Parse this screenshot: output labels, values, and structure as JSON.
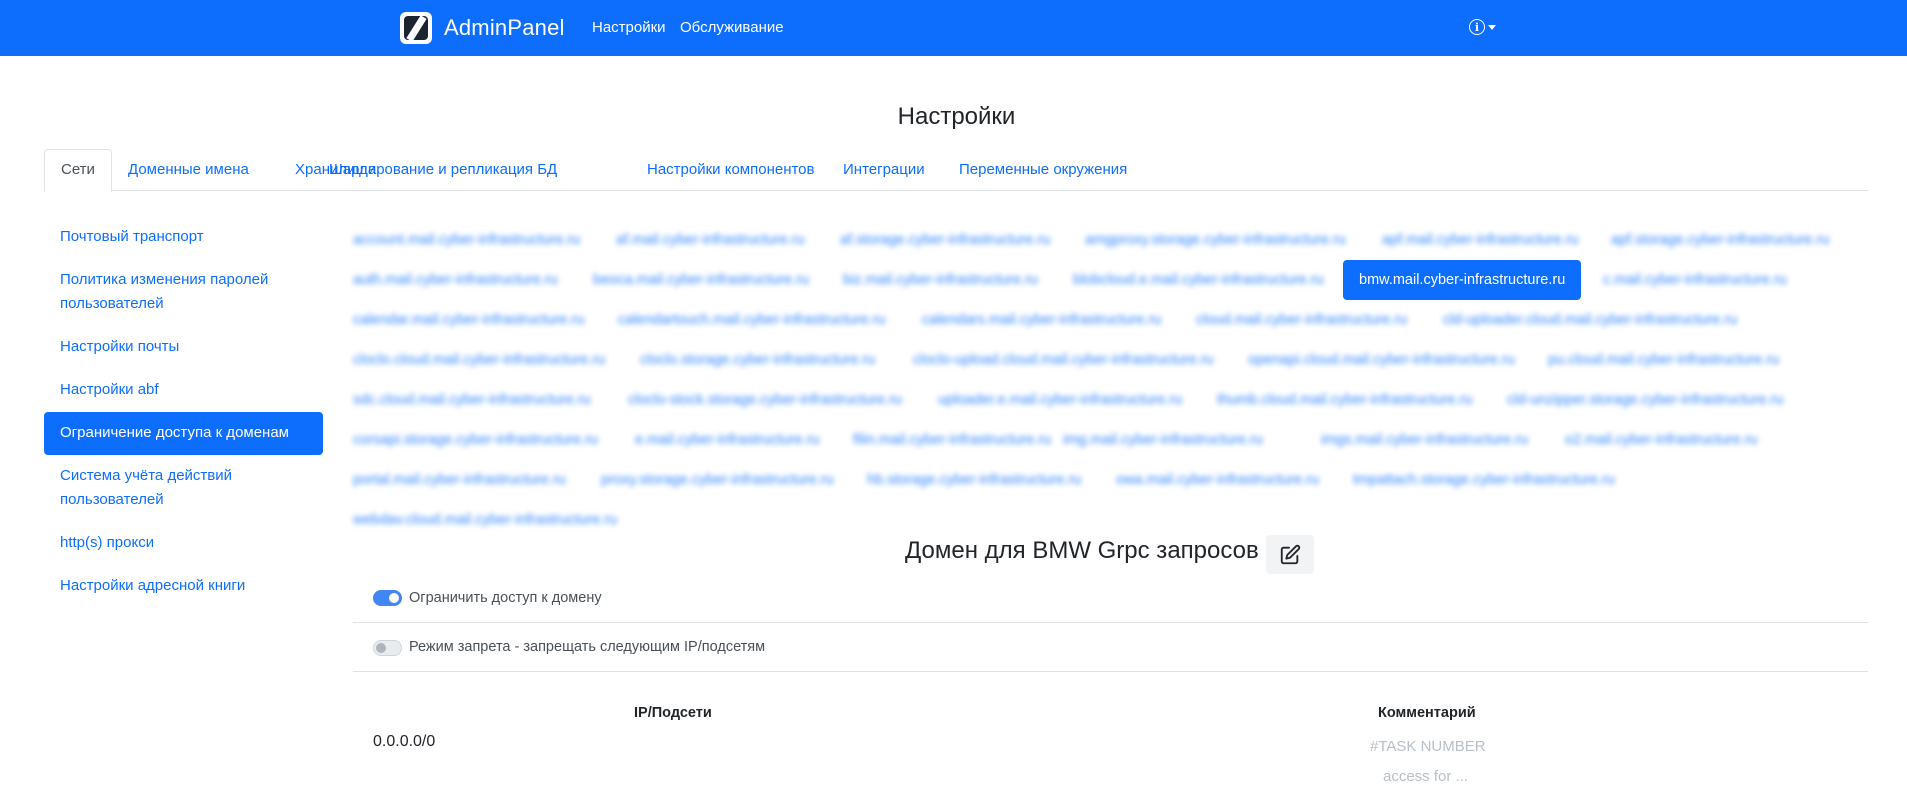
{
  "navbar": {
    "brand": "AdminPanel",
    "links": [
      "Настройки",
      "Обслуживание"
    ],
    "info_icon": "info-circle-icon"
  },
  "page_title": "Настройки",
  "tabs": [
    {
      "label": "Сети",
      "active": true
    },
    {
      "label": "Доменные имена",
      "active": false
    },
    {
      "label": "Хранилища",
      "active": false
    },
    {
      "label": "Шардирование и репликация БД",
      "active": false
    },
    {
      "label": "Настройки компонентов",
      "active": false
    },
    {
      "label": "Интеграции",
      "active": false
    },
    {
      "label": "Переменные окружения",
      "active": false
    }
  ],
  "sidebar": {
    "items": [
      {
        "label": "Почтовый транспорт",
        "active": false
      },
      {
        "label": "Политика изменения паролей пользователей",
        "active": false
      },
      {
        "label": "Настройки почты",
        "active": false
      },
      {
        "label": "Настройки abf",
        "active": false
      },
      {
        "label": "Ограничение доступа к доменам",
        "active": true
      },
      {
        "label": "Система учёта действий пользователей",
        "active": false
      },
      {
        "label": "http(s) прокси",
        "active": false
      },
      {
        "label": "Настройки адресной книги",
        "active": false
      }
    ]
  },
  "domains": {
    "rows": [
      [
        "account.mail.cyber-infrastructure.ru",
        "af.mail.cyber-infrastructure.ru",
        "af.storage.cyber-infrastructure.ru",
        "amgproxy.storage.cyber-infrastructure.ru",
        "apf.mail.cyber-infrastructure.ru",
        "apf.storage.cyber-infrastructure.ru"
      ],
      [
        "auth.mail.cyber-infrastructure.ru",
        "beoca.mail.cyber-infrastructure.ru",
        "biz.mail.cyber-infrastructure.ru",
        "blobcloud.e.mail.cyber-infrastructure.ru",
        "bmw.mail.cyber-infrastructure.ru",
        "c.mail.cyber-infrastructure.ru"
      ],
      [
        "calendar.mail.cyber-infrastructure.ru",
        "calendartouch.mail.cyber-infrastructure.ru",
        "calendars.mail.cyber-infrastructure.ru",
        "cloud.mail.cyber-infrastructure.ru",
        "cld-uploader.cloud.mail.cyber-infrastructure.ru"
      ],
      [
        "cloclo.cloud.mail.cyber-infrastructure.ru",
        "cloclo.storage.cyber-infrastructure.ru",
        "cloclo-upload.cloud.mail.cyber-infrastructure.ru",
        "openapi.cloud.mail.cyber-infrastructure.ru",
        "pu.cloud.mail.cyber-infrastructure.ru"
      ],
      [
        "sdc.cloud.mail.cyber-infrastructure.ru",
        "cloclo-stock.storage.cyber-infrastructure.ru",
        "uploader.e.mail.cyber-infrastructure.ru",
        "thumb.cloud.mail.cyber-infrastructure.ru",
        "cld-unzipper.storage.cyber-infrastructure.ru"
      ],
      [
        "corsapi.storage.cyber-infrastructure.ru",
        "e.mail.cyber-infrastructure.ru",
        "filin.mail.cyber-infrastructure.ru",
        "img.mail.cyber-infrastructure.ru",
        "imgs.mail.cyber-infrastructure.ru",
        "o2.mail.cyber-infrastructure.ru"
      ],
      [
        "portal.mail.cyber-infrastructure.ru",
        "proxy.storage.cyber-infrastructure.ru",
        "hb.storage.cyber-infrastructure.ru",
        "owa.mail.cyber-infrastructure.ru",
        "tmpattach.storage.cyber-infrastructure.ru"
      ],
      [
        "webdav.cloud.mail.cyber-infrastructure.ru"
      ]
    ],
    "selected": "bmw.mail.cyber-infrastructure.ru"
  },
  "section": {
    "title": "Домен для BMW Grpc запросов",
    "edit_icon": "edit-icon",
    "restrict_label": "Ограничить доступ к домену",
    "restrict_on": true,
    "deny_label": "Режим запрета - запрещать следующим IP/подсетям",
    "deny_on": false
  },
  "table": {
    "headers": [
      "IP/Подсети",
      "Комментарий"
    ],
    "rows": [
      {
        "ip": "0.0.0.0/0",
        "comment_placeholder_1": "#TASK NUMBER",
        "comment_placeholder_2": "access for ..."
      }
    ]
  },
  "colors": {
    "primary": "#0d6efd",
    "border": "#dee2e6",
    "switch_on": "#4285f4"
  }
}
